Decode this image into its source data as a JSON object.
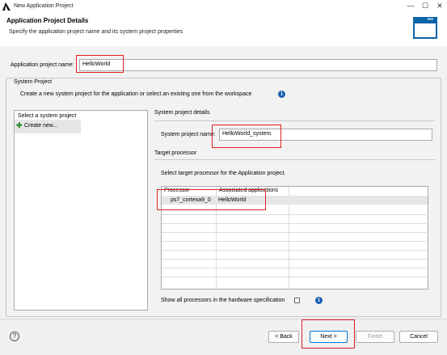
{
  "window": {
    "title": "New Application Project",
    "minimize": "—",
    "maximize": "☐",
    "close": "✕"
  },
  "header": {
    "title": "Application Project Details",
    "subtitle": "Specify the application project name and its system project properties"
  },
  "app_project": {
    "label": "Application project name:",
    "value": "HelloWorld"
  },
  "system_project": {
    "group_title": "System Project",
    "description": "Create a new system project for the application or select an existing one from the workspace",
    "list_header": "Select a system project",
    "list_items": [
      "Create new..."
    ],
    "details_title": "System project details",
    "name_label": "System project name:",
    "name_value": "HelloWorld_system",
    "target_processor_title": "Target processor",
    "select_text": "Select target processor for the Application project.",
    "table_headers": [
      "Processor",
      "Associated applications"
    ],
    "table_rows": [
      {
        "processor": "ps7_cortexa9_0",
        "apps": "HelloWorld"
      }
    ],
    "show_all_label": "Show all processors in the hardware specification"
  },
  "footer": {
    "help": "?",
    "back": "< Back",
    "next": "Next >",
    "finish": "Finish",
    "cancel": "Cancel"
  },
  "colors": {
    "accent": "#0b64a8",
    "highlight_box": "#e02020",
    "selected_row": "#e6e6e6"
  }
}
